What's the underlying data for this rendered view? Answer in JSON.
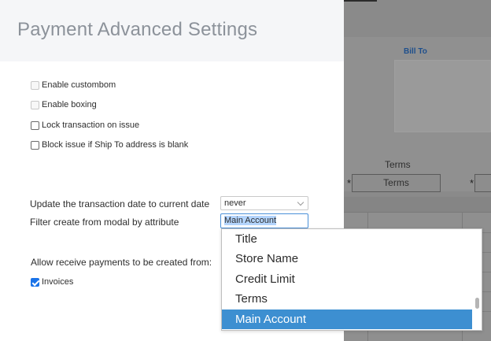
{
  "modal": {
    "title": "Payment Advanced Settings",
    "checkboxes": [
      {
        "label": "Enable custombom",
        "checked": false,
        "disabled": true
      },
      {
        "label": "Enable boxing",
        "checked": false,
        "disabled": true
      },
      {
        "label": "Lock transaction on issue",
        "checked": false,
        "disabled": false
      },
      {
        "label": "Block issue if Ship To address is blank",
        "checked": false,
        "disabled": false
      }
    ],
    "update_date": {
      "label": "Update the transaction date to current date",
      "value": "never"
    },
    "filter_attribute": {
      "label": "Filter create from modal by attribute",
      "value": "Main Account"
    },
    "receive_payments": {
      "label": "Allow receive payments to be created from:",
      "invoices_label": "Invoices",
      "invoices_checked": true
    }
  },
  "dropdown": {
    "options": [
      "Title",
      "Store Name",
      "Credit Limit",
      "Terms",
      "Main Account"
    ],
    "selected": "Main Account"
  },
  "background": {
    "bill_to": "Bill To",
    "terms_label": "Terms",
    "terms_value": "Terms",
    "asterisk": "*"
  }
}
